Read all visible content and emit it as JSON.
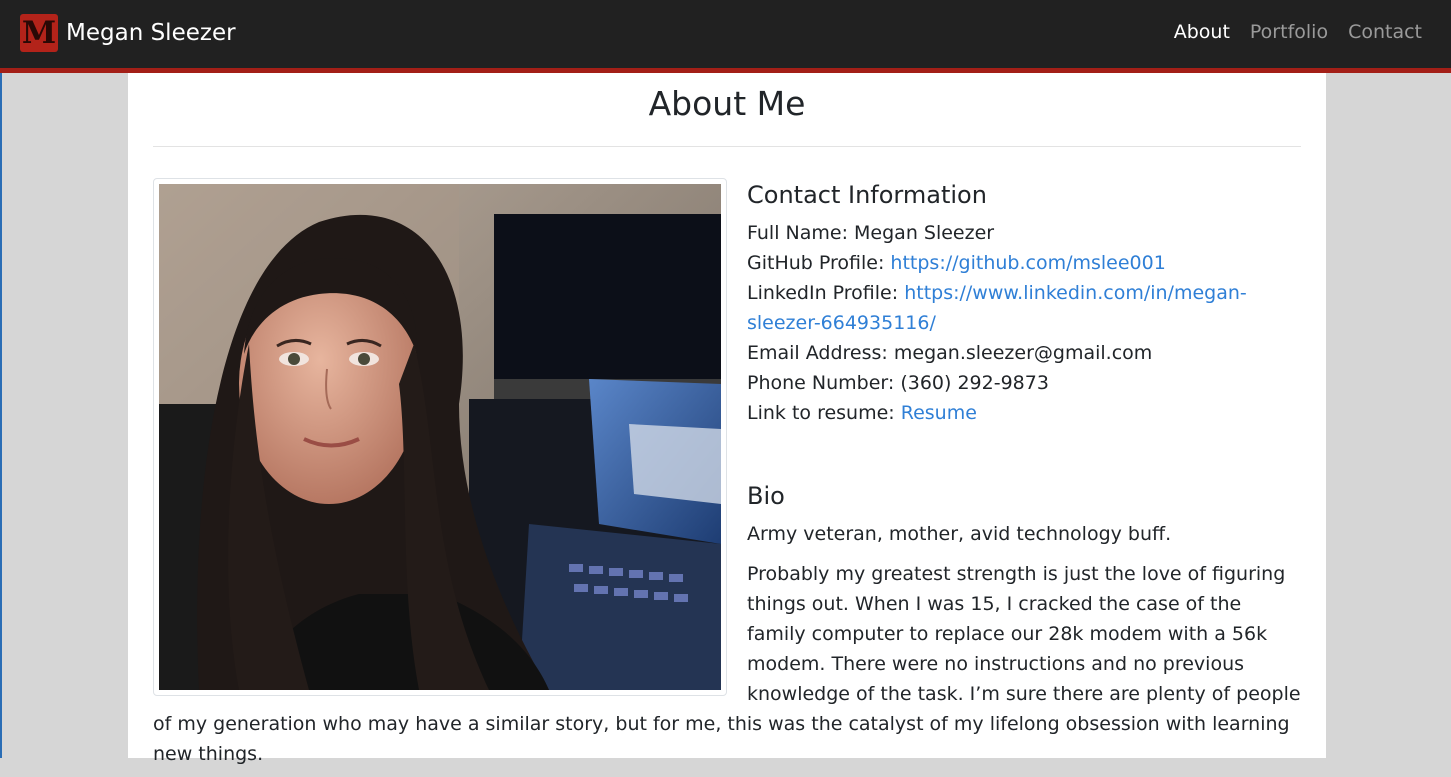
{
  "nav": {
    "logo_letter": "M",
    "brand": "Megan Sleezer",
    "links": [
      "About",
      "Portfolio",
      "Contact"
    ]
  },
  "page": {
    "title": "About Me"
  },
  "contact": {
    "heading": "Contact Information",
    "full_name_label": "Full Name:",
    "full_name": "Megan Sleezer",
    "github_label": "GitHub Profile:",
    "github_url": "https://github.com/mslee001",
    "linkedin_label": "LinkedIn Profile:",
    "linkedin_url": "https://www.linkedin.com/in/megan-sleezer-664935116/",
    "email_label": "Email Address:",
    "email": "megan.sleezer@gmail.com",
    "phone_label": "Phone Number:",
    "phone": "(360) 292-9873",
    "resume_label": "Link to resume:",
    "resume_link": "Resume"
  },
  "bio": {
    "heading": "Bio",
    "p1": "Army veteran, mother, avid technology buff.",
    "p2": "Probably my greatest strength is just the love of figuring things out. When I was 15, I cracked the case of the family computer to replace our 28k modem with a 56k modem. There were no instructions and no previous knowledge of the task. I’m sure there are plenty of people of my generation who may have a similar story, but for me, this was the catalyst of my lifelong obsession with learning new things."
  },
  "colors": {
    "navbar_bg": "#212121",
    "accent": "#a31f17",
    "link": "#2f7fd6"
  }
}
